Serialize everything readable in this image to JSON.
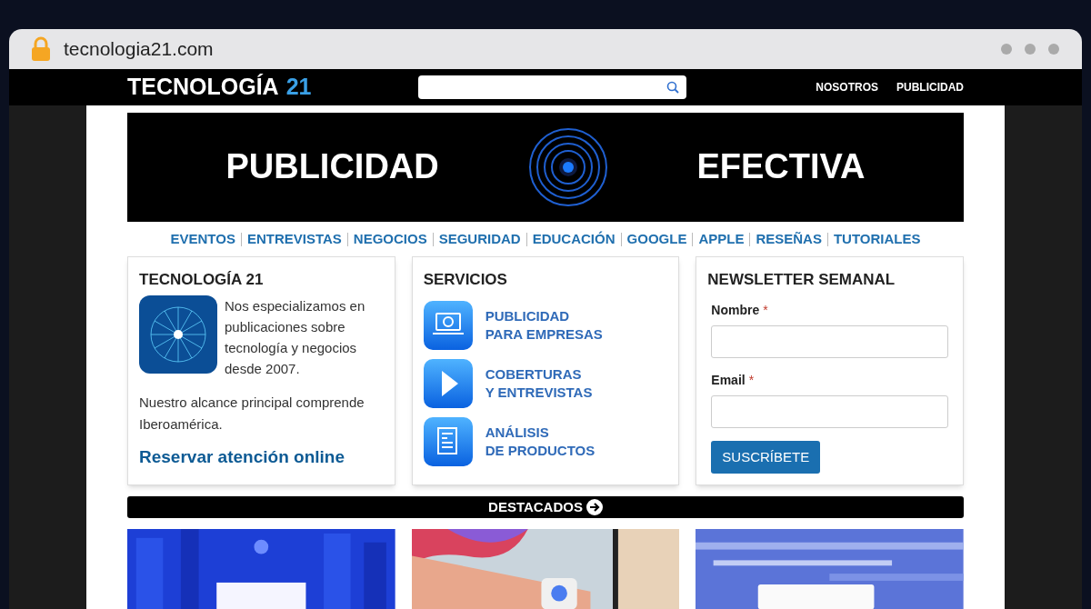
{
  "browser": {
    "url": "tecnologia21.com"
  },
  "header": {
    "logo": "TECNOLOGÍA",
    "logo_number": "21",
    "links": [
      "NOSOTROS",
      "PUBLICIDAD"
    ]
  },
  "banner": {
    "left": "PUBLICIDAD",
    "right": "EFECTIVA"
  },
  "categories": [
    "EVENTOS",
    "ENTREVISTAS",
    "NEGOCIOS",
    "SEGURIDAD",
    "EDUCACIÓN",
    "GOOGLE",
    "APPLE",
    "RESEÑAS",
    "TUTORIALES"
  ],
  "about": {
    "title": "TECNOLOGÍA 21",
    "text": "Nos especializamos en publicaciones sobre tecnología y negocios desde 2007.",
    "reach": "Nuestro alcance principal comprende Iberoamérica.",
    "link": "Reservar atención online"
  },
  "services": {
    "title": "SERVICIOS",
    "items": [
      {
        "kind": "web",
        "line1": "PUBLICIDAD",
        "line2": "PARA EMPRESAS"
      },
      {
        "kind": "video",
        "line1": "COBERTURAS",
        "line2": "Y ENTREVISTAS"
      },
      {
        "kind": "document",
        "line1": "ANÁLISIS",
        "line2": "DE PRODUCTOS"
      }
    ]
  },
  "newsletter": {
    "title": "NEWSLETTER SEMANAL",
    "fields": [
      {
        "label": "Nombre",
        "required_mark": "*"
      },
      {
        "label": "Email",
        "required_mark": "*"
      }
    ],
    "button": "SUSCRÍBETE"
  },
  "featured": {
    "title": "DESTACADOS"
  }
}
